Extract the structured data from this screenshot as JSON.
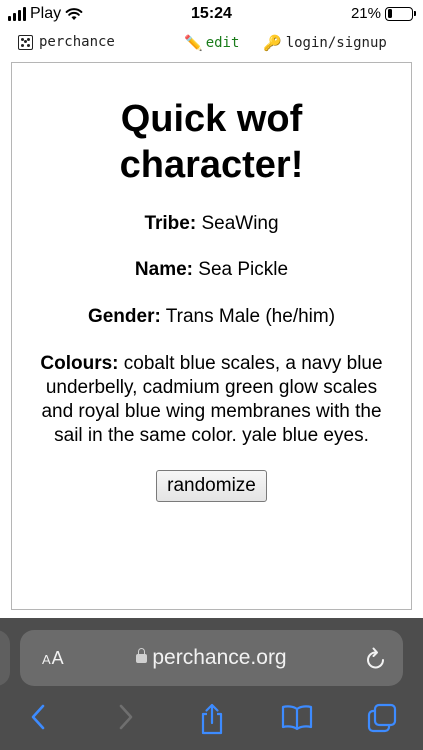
{
  "status_bar": {
    "carrier": "Play",
    "time": "15:24",
    "battery_percent": "21%",
    "battery_level": 0.21
  },
  "site_nav": {
    "home_label": "perchance",
    "edit_label": "edit",
    "login_label": "login/signup",
    "edit_color": "#1a7c1a"
  },
  "content": {
    "title": "Quick wof character!",
    "fields": {
      "tribe_label": "Tribe:",
      "tribe_value": "SeaWing",
      "name_label": "Name:",
      "name_value": "Sea Pickle",
      "gender_label": "Gender:",
      "gender_value": "Trans Male (he/him)",
      "colours_label": "Colours:",
      "colours_value": "cobalt blue scales, a navy blue underbelly, cadmium green glow scales and royal blue wing membranes with the sail in the same color. yale blue eyes."
    },
    "randomize_label": "randomize"
  },
  "browser": {
    "text_size_big": "A",
    "text_size_small": "A",
    "url": "perchance.org",
    "icons": [
      "lock-icon",
      "reload-icon",
      "back-icon",
      "forward-icon",
      "share-icon",
      "bookmarks-icon",
      "tabs-icon"
    ],
    "accent_color": "#3d8bff"
  }
}
